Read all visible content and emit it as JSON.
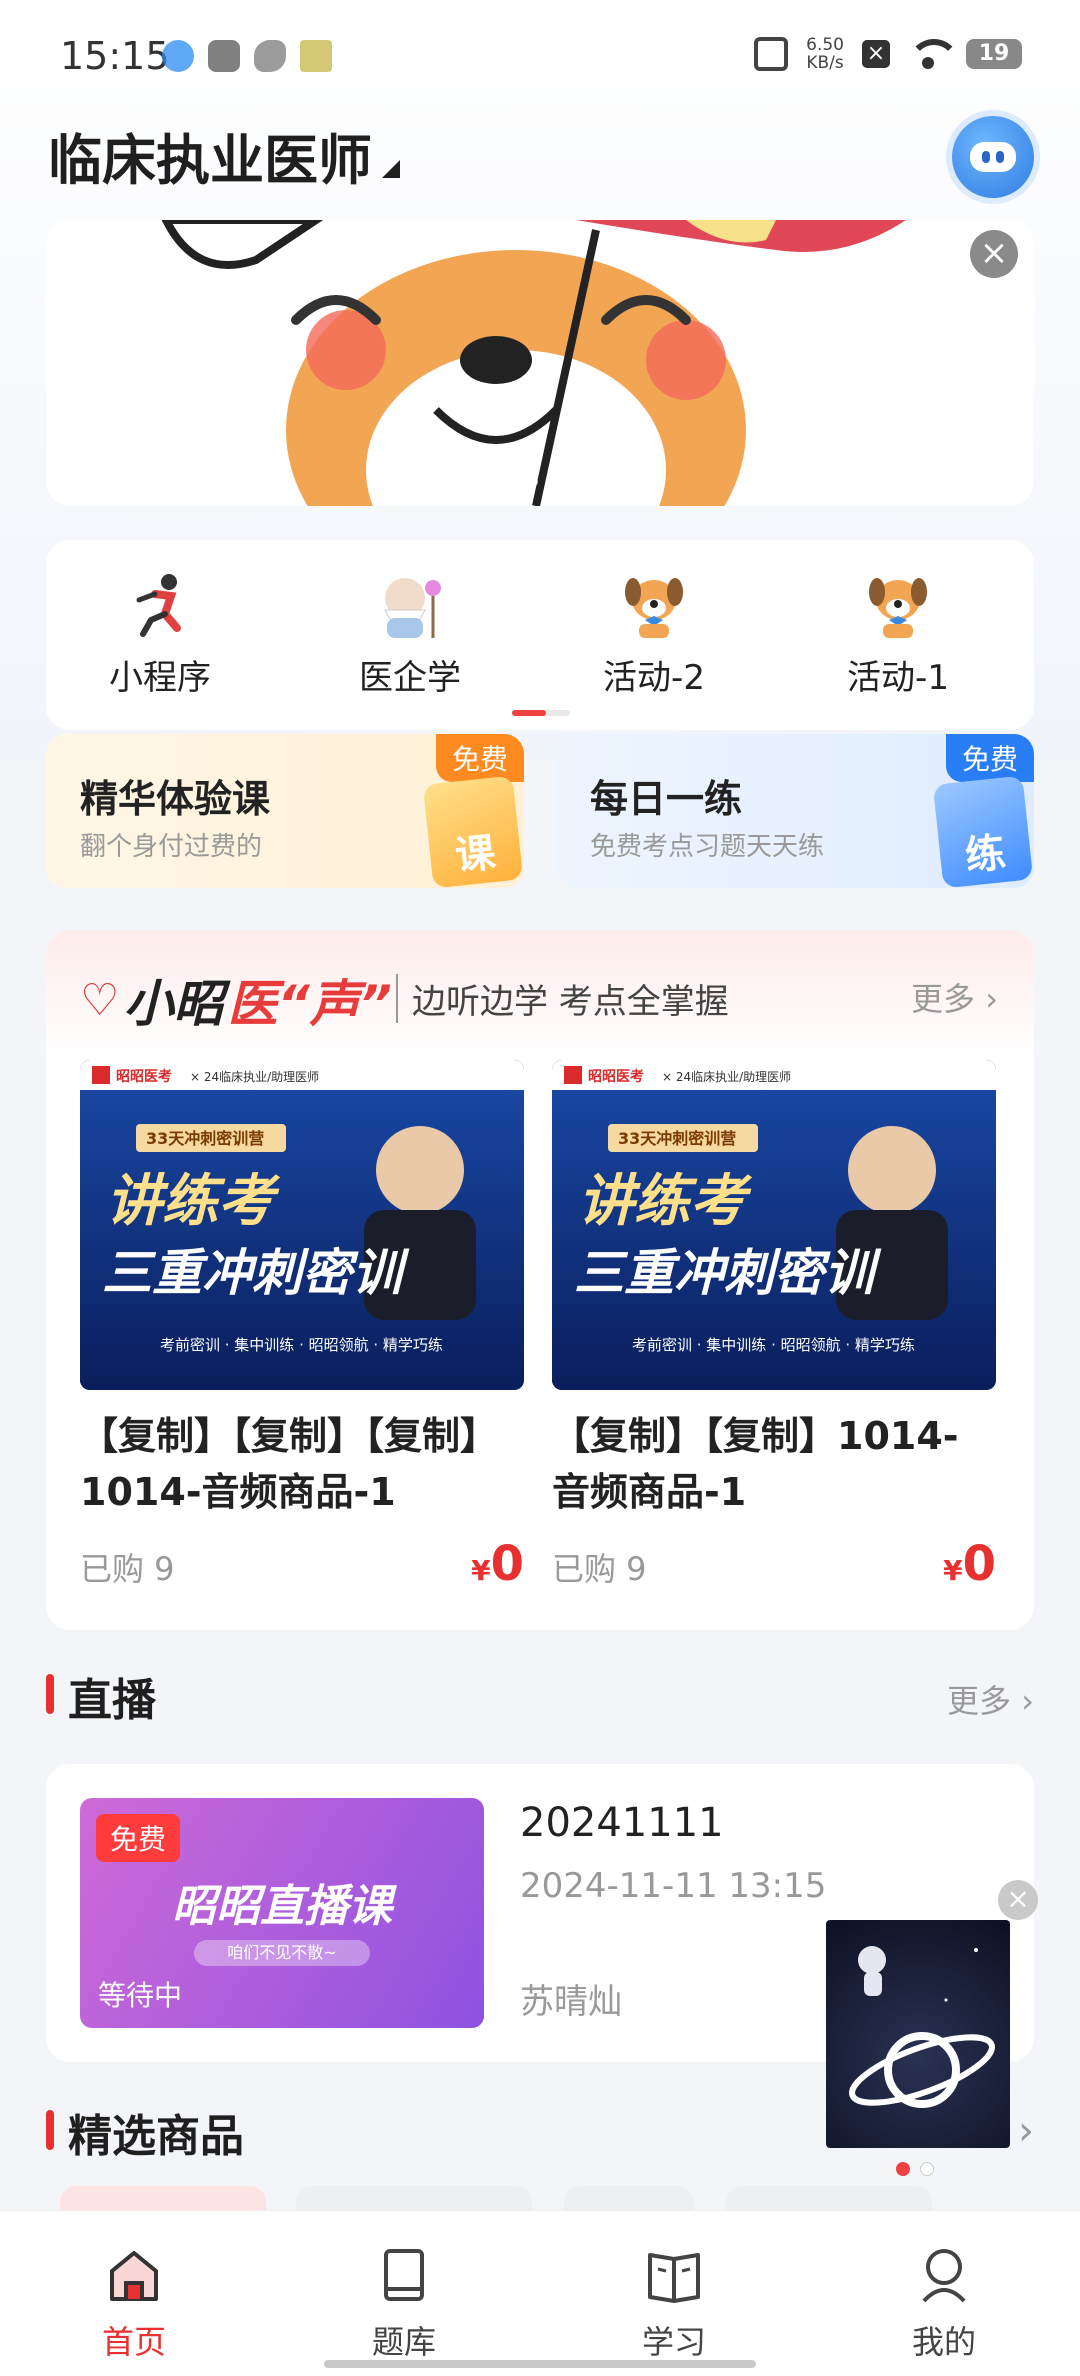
{
  "status_bar": {
    "time": "15:15",
    "net_speed_value": "6.50",
    "net_speed_unit": "KB/s",
    "battery": "19"
  },
  "header": {
    "title": "临床执业医师"
  },
  "quick_nav": [
    {
      "label": "小程序",
      "icon": "runner-icon"
    },
    {
      "label": "医企学",
      "icon": "sage-icon"
    },
    {
      "label": "活动-2",
      "icon": "dog-mascot-icon"
    },
    {
      "label": "活动-1",
      "icon": "dog-mascot-icon"
    }
  ],
  "features": [
    {
      "title": "精华体验课",
      "subtitle": "翻个身付过费的",
      "badge": "免费",
      "art": "课"
    },
    {
      "title": "每日一练",
      "subtitle": "免费考点习题天天练",
      "badge": "免费",
      "art": "练"
    }
  ],
  "audio_section": {
    "logo_text_1": "小昭",
    "logo_text_2": "医“声”",
    "slogan": "边听边学 考点全掌握",
    "more": "更多",
    "products": [
      {
        "brand": "昭昭医考",
        "brand_sub": "× 24临床执业/助理医师",
        "poster_tag": "33天冲刺密训营",
        "poster_line1": "讲练考",
        "poster_line2": "三重冲刺密训",
        "poster_footer": "考前密训 · 集中训练 · 昭昭领航 · 精学巧练",
        "title": "【复制】【复制】【复制】1014-音频商品-1",
        "sold": "已购 9",
        "currency": "¥",
        "price": "0"
      },
      {
        "brand": "昭昭医考",
        "brand_sub": "× 24临床执业/助理医师",
        "poster_tag": "33天冲刺密训营",
        "poster_line1": "讲练考",
        "poster_line2": "三重冲刺密训",
        "poster_footer": "考前密训 · 集中训练 · 昭昭领航 · 精学巧练",
        "title": "【复制】【复制】1014-音频商品-1",
        "sold": "已购 9",
        "currency": "¥",
        "price": "0"
      }
    ]
  },
  "live_section": {
    "title": "直播",
    "more": "更多",
    "card": {
      "badge": "免费",
      "thumb_title": "昭昭直播课",
      "thumb_sub": "咱们不见不散~",
      "status": "等待中",
      "title": "20241111",
      "time": "2024-11-11 13:15",
      "teacher": "苏晴灿"
    }
  },
  "selected_section": {
    "title": "精选商品"
  },
  "bottom_nav": [
    {
      "label": "首页",
      "icon": "home-icon",
      "active": true
    },
    {
      "label": "题库",
      "icon": "book-icon",
      "active": false
    },
    {
      "label": "学习",
      "icon": "open-book-icon",
      "active": false
    },
    {
      "label": "我的",
      "icon": "user-icon",
      "active": false
    }
  ],
  "colors": {
    "accent": "#e83030",
    "blue": "#2a7ef5",
    "orange": "#ff8a1f"
  }
}
